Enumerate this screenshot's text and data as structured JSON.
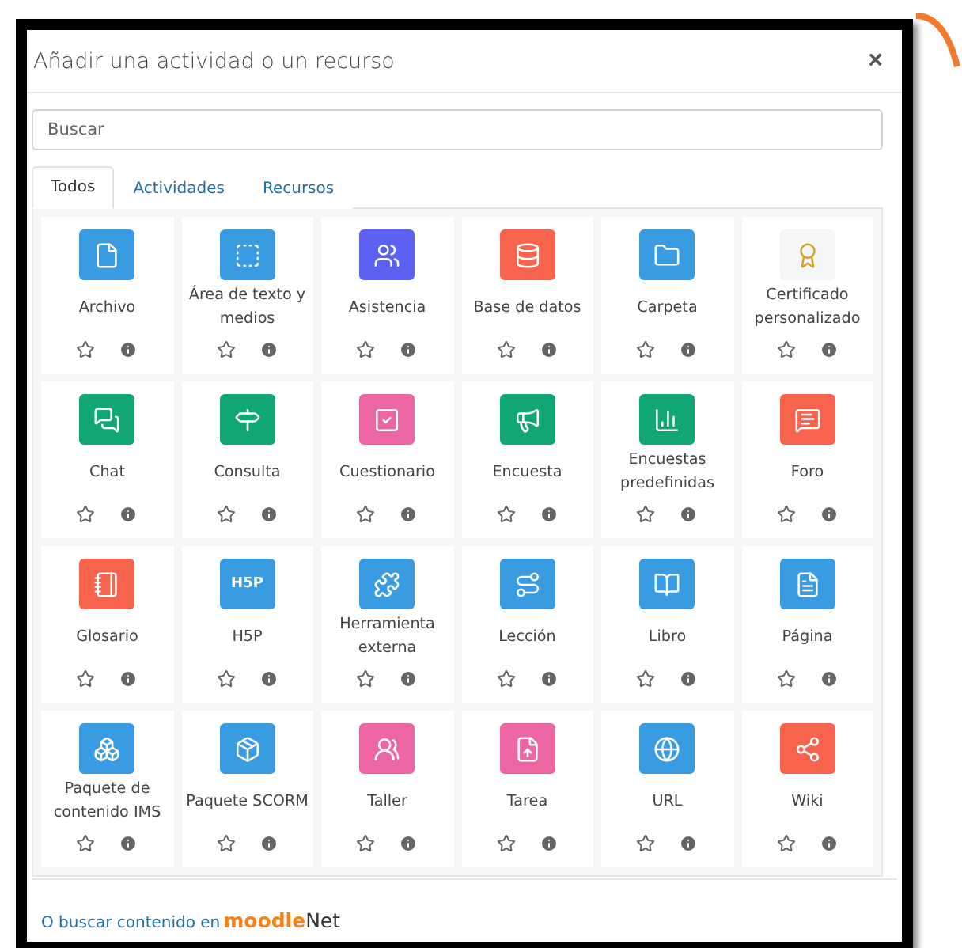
{
  "dialog": {
    "title": "Añadir una actividad o un recurso",
    "close": "×"
  },
  "search": {
    "placeholder": "Buscar"
  },
  "tabs": [
    {
      "label": "Todos",
      "selected": true
    },
    {
      "label": "Actividades",
      "selected": false
    },
    {
      "label": "Recursos",
      "selected": false
    }
  ],
  "items": [
    {
      "label": "Archivo",
      "color": "#399be2",
      "starred": false
    },
    {
      "label": "Área de texto y medios",
      "color": "#399be2",
      "starred": false
    },
    {
      "label": "Asistencia",
      "color": "#5b62f1",
      "starred": false
    },
    {
      "label": "Base de datos",
      "color": "#f7634d",
      "starred": false
    },
    {
      "label": "Carpeta",
      "color": "#399be2",
      "starred": false
    },
    {
      "label": "Certificado personalizado",
      "color": "#f5f6f8",
      "starred": false
    },
    {
      "label": "Chat",
      "color": "#11a676",
      "starred": false
    },
    {
      "label": "Consulta",
      "color": "#11a676",
      "starred": false
    },
    {
      "label": "Cuestionario",
      "color": "#eb66a2",
      "starred": false
    },
    {
      "label": "Encuesta",
      "color": "#11a676",
      "starred": false
    },
    {
      "label": "Encuestas predefinidas",
      "color": "#11a676",
      "starred": false
    },
    {
      "label": "Foro",
      "color": "#f7634d",
      "starred": false
    },
    {
      "label": "Glosario",
      "color": "#f7634d",
      "starred": false
    },
    {
      "label": "H5P",
      "color": "#399be2",
      "starred": false,
      "logo_text": "H5P"
    },
    {
      "label": "Herramienta externa",
      "color": "#399be2",
      "starred": false
    },
    {
      "label": "Lección",
      "color": "#399be2",
      "starred": false
    },
    {
      "label": "Libro",
      "color": "#399be2",
      "starred": false
    },
    {
      "label": "Página",
      "color": "#399be2",
      "starred": false
    },
    {
      "label": "Paquete de contenido IMS",
      "color": "#399be2",
      "starred": false
    },
    {
      "label": "Paquete SCORM",
      "color": "#399be2",
      "starred": false
    },
    {
      "label": "Taller",
      "color": "#eb66a2",
      "starred": false
    },
    {
      "label": "Tarea",
      "color": "#eb66a2",
      "starred": false
    },
    {
      "label": "URL",
      "color": "#399be2",
      "starred": false
    },
    {
      "label": "Wiki",
      "color": "#f7634d",
      "starred": false
    }
  ],
  "footer": {
    "link": "O buscar contenido en",
    "logo_main": "moodle",
    "logo_suffix": "Net"
  }
}
